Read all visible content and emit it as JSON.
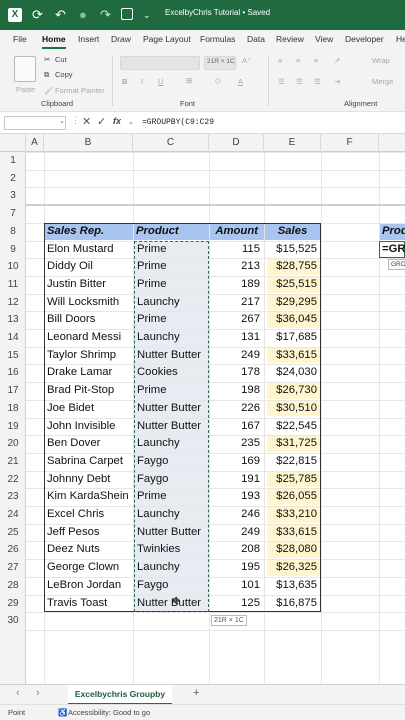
{
  "title_bar": {
    "doc_title": "ExcelbyChris Tutorial • Saved",
    "icons": [
      "excel-logo-icon",
      "save-icon",
      "undo-icon",
      "redo-icon",
      "autosave-toggle-icon",
      "grid-icon",
      "more-icon"
    ]
  },
  "menu": {
    "items": [
      "File",
      "Home",
      "Insert",
      "Draw",
      "Page Layout",
      "Formulas",
      "Data",
      "Review",
      "View",
      "Developer",
      "He"
    ],
    "active": "Home"
  },
  "ribbon": {
    "clipboard": {
      "paste": "Paste",
      "cut": "Cut",
      "copy": "Copy",
      "format_painter": "Format Painter",
      "group_label": "Clipboard"
    },
    "font": {
      "size": "21R × 1C",
      "bold": "B",
      "italic": "I",
      "underline": "U",
      "font_color": "A",
      "group_label": "Font"
    },
    "alignment": {
      "wrap": "Wrap",
      "merge": "Merge",
      "group_label": "Alignment"
    }
  },
  "formula_bar": {
    "name_box": "",
    "cancel": "✕",
    "enter": "✓",
    "fx": "fx",
    "formula": "=GROUPBY(C9:C29"
  },
  "grid": {
    "columns": [
      "A",
      "B",
      "C",
      "D",
      "E",
      "F"
    ],
    "rows": [
      "1",
      "2",
      "3",
      "7",
      "8",
      "9",
      "10",
      "11",
      "12",
      "13",
      "14",
      "15",
      "16",
      "17",
      "18",
      "19",
      "20",
      "21",
      "22",
      "23",
      "24",
      "25",
      "26",
      "27",
      "28",
      "29",
      "30"
    ],
    "table_headers": {
      "rep": "Sales Rep.",
      "product": "Product",
      "amount": "Amount",
      "sales": "Sales"
    },
    "data": [
      [
        "Elon Mustard",
        "Prime",
        "115",
        "$15,525"
      ],
      [
        "Diddy Oil",
        "Prime",
        "213",
        "$28,755"
      ],
      [
        "Justin Bitter",
        "Prime",
        "189",
        "$25,515"
      ],
      [
        "Will Locksmith",
        "Launchy",
        "217",
        "$29,295"
      ],
      [
        "Bill Doors",
        "Prime",
        "267",
        "$36,045"
      ],
      [
        "Leonard Messi",
        "Launchy",
        "131",
        "$17,685"
      ],
      [
        "Taylor Shrimp",
        "Nutter Butter",
        "249",
        "$33,615"
      ],
      [
        "Drake Lamar",
        "Cookies",
        "178",
        "$24,030"
      ],
      [
        "Brad Pit-Stop",
        "Prime",
        "198",
        "$26,730"
      ],
      [
        "Joe Bidet",
        "Nutter Butter",
        "226",
        "$30,510"
      ],
      [
        "John Invisible",
        "Nutter Butter",
        "167",
        "$22,545"
      ],
      [
        "Ben Dover",
        "Launchy",
        "235",
        "$31,725"
      ],
      [
        "Sabrina Carpet",
        "Faygo",
        "169",
        "$22,815"
      ],
      [
        "Johnny Debt",
        "Faygo",
        "191",
        "$25,785"
      ],
      [
        "Kim KardaShein",
        "Prime",
        "193",
        "$26,055"
      ],
      [
        "Excel Chris",
        "Launchy",
        "246",
        "$33,210"
      ],
      [
        "Jeff Pesos",
        "Nutter Butter",
        "249",
        "$33,615"
      ],
      [
        "Deez Nuts",
        "Twinkies",
        "208",
        "$28,080"
      ],
      [
        "George Clown",
        "Launchy",
        "195",
        "$26,325"
      ],
      [
        "LeBron Jordan",
        "Faygo",
        "101",
        "$13,635"
      ],
      [
        "Travis Toast",
        "Nutter Butter",
        "125",
        "$16,875"
      ]
    ],
    "side_header": "Prod",
    "editing_cell": "=GR",
    "tooltip": "GRO",
    "selection_badge": "21R × 1C"
  },
  "sheet_tabs": {
    "active": "Excelbychris Groupby",
    "add": "+"
  },
  "status_bar": {
    "mode": "Point",
    "accessibility": "Accessibility: Good to go"
  },
  "colors": {
    "title_bar": "#1f6b3f",
    "table_header": "#a9c4ee",
    "sales_highlight": "#fff5cf",
    "selection_fill": "#e7ecf2",
    "accent": "#1e7145"
  }
}
